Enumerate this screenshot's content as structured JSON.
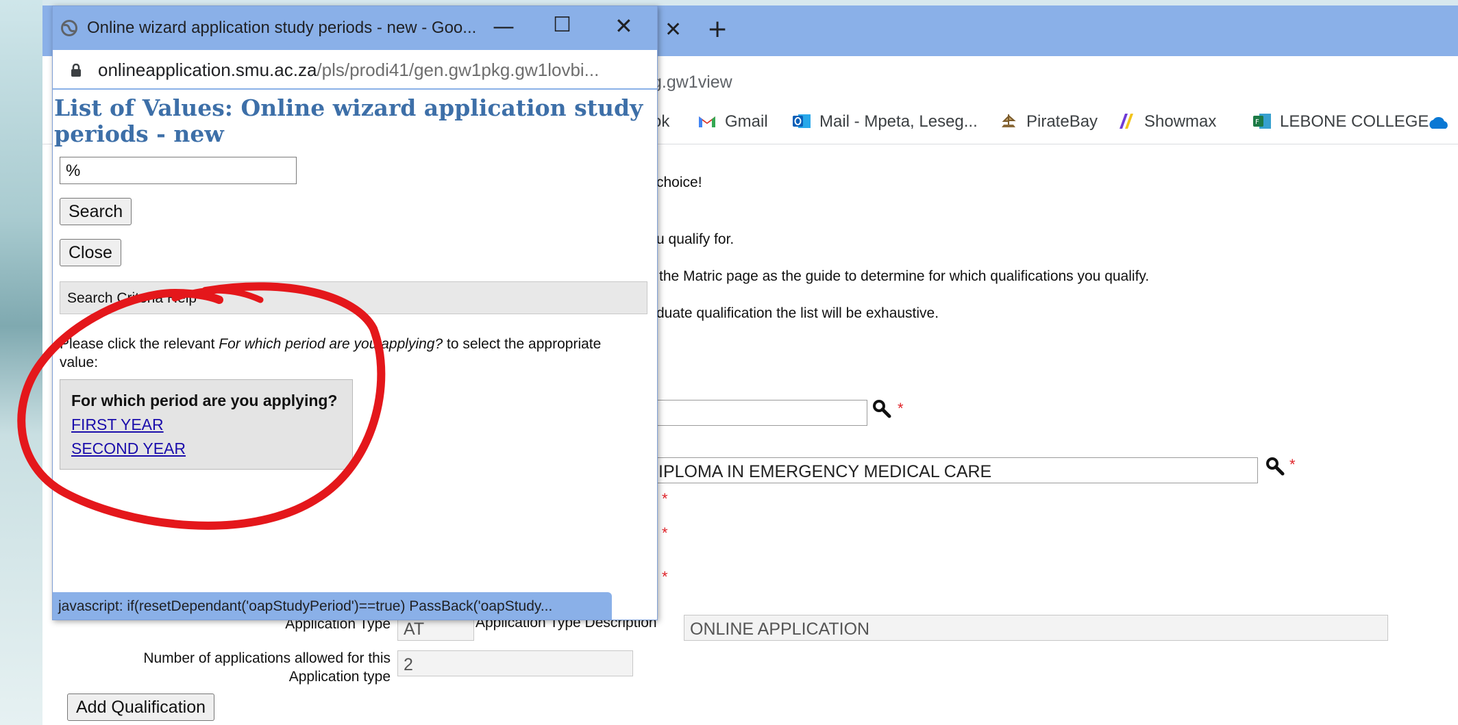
{
  "main_browser": {
    "tab_close_glyph": "✕",
    "tab_new_glyph": "+",
    "url_visible_tail": "g.gw1view",
    "bookmarks": [
      {
        "label": "ok",
        "icon": "bookmark-partial-icon"
      },
      {
        "label": "Gmail",
        "icon": "gmail-icon"
      },
      {
        "label": "Mail - Mpeta, Leseg...",
        "icon": "outlook-mail-icon"
      },
      {
        "label": "PirateBay",
        "icon": "piratebay-icon"
      },
      {
        "label": "Showmax",
        "icon": "showmax-icon"
      },
      {
        "label": "LEBONE COLLEGE...",
        "icon": "lebone-college-icon"
      }
    ]
  },
  "page": {
    "text_lines": [
      "choice!",
      "u qualify for.",
      "the Matric page as the guide to determine for which qualifications you qualify.",
      "duate qualification the list will be exhaustive."
    ],
    "qualification_value": "IPLOMA IN EMERGENCY MEDICAL CARE",
    "required_marker": "*",
    "application_type_label": "Application Type",
    "application_type_value": "AT",
    "application_type_description_label": "Application Type Description",
    "application_type_description_value": "ONLINE APPLICATION",
    "number_allowed_label": "Number of applications allowed for this Application type",
    "number_allowed_value": "2",
    "add_qualification_button": "Add Qualification"
  },
  "popup": {
    "window_title": "Online wizard application study periods - new - Goo...",
    "minimize_glyph": "—",
    "maximize_glyph": "☐",
    "close_glyph": "✕",
    "url_host": "onlineapplication.smu.ac.za",
    "url_path": "/pls/prodi41/gen.gw1pkg.gw1lovbi...",
    "heading": "List of Values: Online wizard application study periods - new",
    "search_value": "%",
    "search_button": "Search",
    "close_button": "Close",
    "help_bar_label": "Search Criteria Help",
    "instruction_pre": "Please click the relevant ",
    "instruction_italic": "For which period are you applying?",
    "instruction_post": " to select the appropriate value:",
    "list_header": "For which period are you applying?",
    "options": [
      "FIRST YEAR",
      "SECOND YEAR"
    ],
    "status_bar": "javascript: if(resetDependant('oapStudyPeriod')==true) PassBack('oapStudy..."
  },
  "colors": {
    "chrome_tab_bar": "#8ab0e8",
    "lov_heading": "#3d6fa8",
    "link": "#1a0dab",
    "required": "#e0242a",
    "annotation": "#e4171b"
  }
}
